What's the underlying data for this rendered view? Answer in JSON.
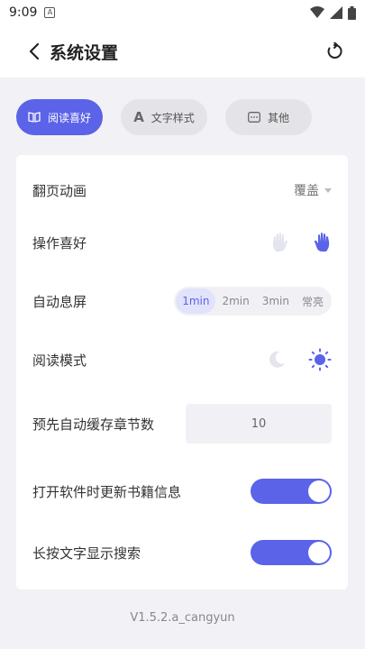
{
  "status_bar": {
    "time": "9:09",
    "left_icon": "A"
  },
  "header": {
    "title": "系统设置",
    "back_icon": "chevron-left-icon",
    "refresh_icon": "refresh-icon"
  },
  "tabs": [
    {
      "label": "阅读喜好",
      "icon": "book-icon",
      "active": true
    },
    {
      "label": "文字样式",
      "icon": "letter-a-icon",
      "active": false
    },
    {
      "label": "其他",
      "icon": "more-dots-icon",
      "active": false
    }
  ],
  "settings": {
    "page_turn": {
      "label": "翻页动画",
      "value": "覆盖"
    },
    "operation": {
      "label": "操作喜好",
      "options": [
        "left-hand-icon",
        "right-hand-icon"
      ],
      "selected": "right-hand-icon"
    },
    "auto_screen_off": {
      "label": "自动息屏",
      "options": [
        "1min",
        "2min",
        "3min",
        "常亮"
      ],
      "selected": "1min"
    },
    "read_mode": {
      "label": "阅读模式",
      "options": [
        "moon-icon",
        "sun-icon"
      ],
      "selected": "sun-icon"
    },
    "cache_chapters": {
      "label": "预先自动缓存章节数",
      "value": "10"
    },
    "update_on_open": {
      "label": "打开软件时更新书籍信息",
      "enabled": true
    },
    "long_press_search": {
      "label": "长按文字显示搜索",
      "enabled": true
    }
  },
  "version": "V1.5.2.a_cangyun",
  "colors": {
    "accent": "#5b63e8",
    "background": "#f2f2f6",
    "card": "#ffffff"
  }
}
